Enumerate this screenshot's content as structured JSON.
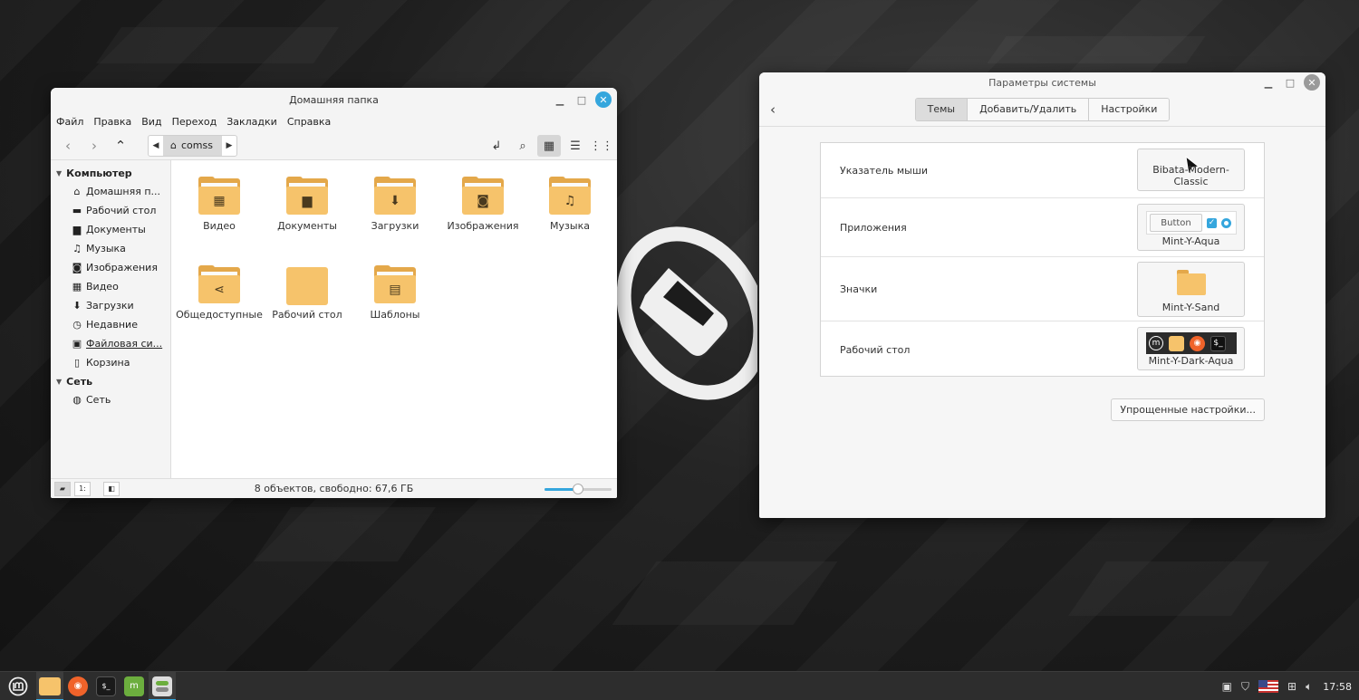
{
  "colors": {
    "accent": "#35a6dd",
    "folder_front": "#f6c36b",
    "folder_back": "#e4a84a",
    "mint_green": "#6cae3e",
    "firefox_orange": "#f0632a"
  },
  "file_manager": {
    "title": "Домашняя папка",
    "menu": [
      "Файл",
      "Правка",
      "Вид",
      "Переход",
      "Закладки",
      "Справка"
    ],
    "path": {
      "crumb": "comss"
    },
    "sidebar": {
      "computer": {
        "label": "Компьютер",
        "items": [
          {
            "label": "Домашняя п...",
            "icon": "home-icon"
          },
          {
            "label": "Рабочий стол",
            "icon": "desktop-icon"
          },
          {
            "label": "Документы",
            "icon": "document-icon"
          },
          {
            "label": "Музыка",
            "icon": "music-icon"
          },
          {
            "label": "Изображения",
            "icon": "camera-icon"
          },
          {
            "label": "Видео",
            "icon": "film-icon"
          },
          {
            "label": "Загрузки",
            "icon": "download-icon"
          },
          {
            "label": "Недавние",
            "icon": "clock-icon"
          },
          {
            "label": "Файловая си...",
            "icon": "drive-icon"
          },
          {
            "label": "Корзина",
            "icon": "trash-icon"
          }
        ]
      },
      "network": {
        "label": "Сеть",
        "items": [
          {
            "label": "Сеть",
            "icon": "network-icon"
          }
        ]
      }
    },
    "items": [
      {
        "label": "Видео",
        "icon": "film-icon",
        "glyph": "▦"
      },
      {
        "label": "Документы",
        "icon": "document-icon",
        "glyph": "▆"
      },
      {
        "label": "Загрузки",
        "icon": "download-icon",
        "glyph": "⬇"
      },
      {
        "label": "Изображения",
        "icon": "camera-icon",
        "glyph": "◙"
      },
      {
        "label": "Музыка",
        "icon": "music-icon",
        "glyph": "♫"
      },
      {
        "label": "Общедоступные",
        "icon": "share-icon",
        "glyph": "⋖"
      },
      {
        "label": "Рабочий стол",
        "icon": "desktop-folder-icon",
        "glyph": ""
      },
      {
        "label": "Шаблоны",
        "icon": "template-icon",
        "glyph": "▤"
      }
    ],
    "status": "8 объектов, свободно: 67,6 ГБ",
    "zoom_level": 0.5
  },
  "settings": {
    "title": "Параметры системы",
    "tabs": [
      "Темы",
      "Добавить/Удалить",
      "Настройки"
    ],
    "selected_tab": "Темы",
    "rows": [
      {
        "label": "Указатель мыши",
        "value": "Bibata-Modern-Classic"
      },
      {
        "label": "Приложения",
        "value": "Mint-Y-Aqua",
        "preview_button": "Button"
      },
      {
        "label": "Значки",
        "value": "Mint-Y-Sand"
      },
      {
        "label": "Рабочий стол",
        "value": "Mint-Y-Dark-Aqua"
      }
    ],
    "simple_button": "Упрощенные настройки..."
  },
  "taskbar": {
    "clock": "17:58"
  }
}
